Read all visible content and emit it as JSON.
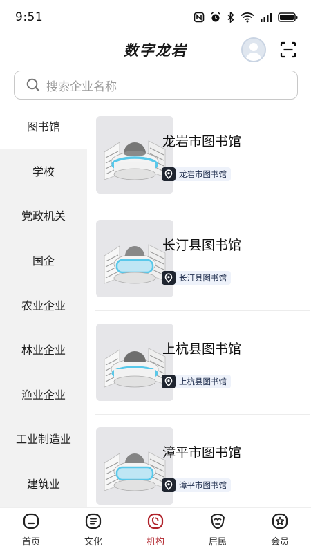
{
  "status_bar": {
    "time": "9:51"
  },
  "header": {
    "title": "数字龙岩"
  },
  "search": {
    "placeholder": "搜索企业名称"
  },
  "sidebar": {
    "items": [
      {
        "label": "图书馆",
        "active": true
      },
      {
        "label": "学校",
        "active": false
      },
      {
        "label": "党政机关",
        "active": false
      },
      {
        "label": "国企",
        "active": false
      },
      {
        "label": "农业企业",
        "active": false
      },
      {
        "label": "林业企业",
        "active": false
      },
      {
        "label": "渔业企业",
        "active": false
      },
      {
        "label": "工业制造业",
        "active": false
      },
      {
        "label": "建筑业",
        "active": false
      }
    ]
  },
  "list": {
    "items": [
      {
        "name": "龙岩市图书馆",
        "tag": "龙岩市图书馆"
      },
      {
        "name": "长汀县图书馆",
        "tag": "长汀县图书馆"
      },
      {
        "name": "上杭县图书馆",
        "tag": "上杭县图书馆"
      },
      {
        "name": "漳平市图书馆",
        "tag": "漳平市图书馆"
      }
    ]
  },
  "bottom_nav": {
    "items": [
      {
        "label": "首页",
        "icon": "home-icon",
        "active": false
      },
      {
        "label": "文化",
        "icon": "culture-icon",
        "active": false
      },
      {
        "label": "机构",
        "icon": "institution-icon",
        "active": true
      },
      {
        "label": "居民",
        "icon": "resident-icon",
        "active": false
      },
      {
        "label": "会员",
        "icon": "member-icon",
        "active": false
      }
    ]
  },
  "colors": {
    "accent": "#b0222a",
    "sidebar_bg": "#f2f2f2",
    "tag_bg": "#eef2fa"
  }
}
